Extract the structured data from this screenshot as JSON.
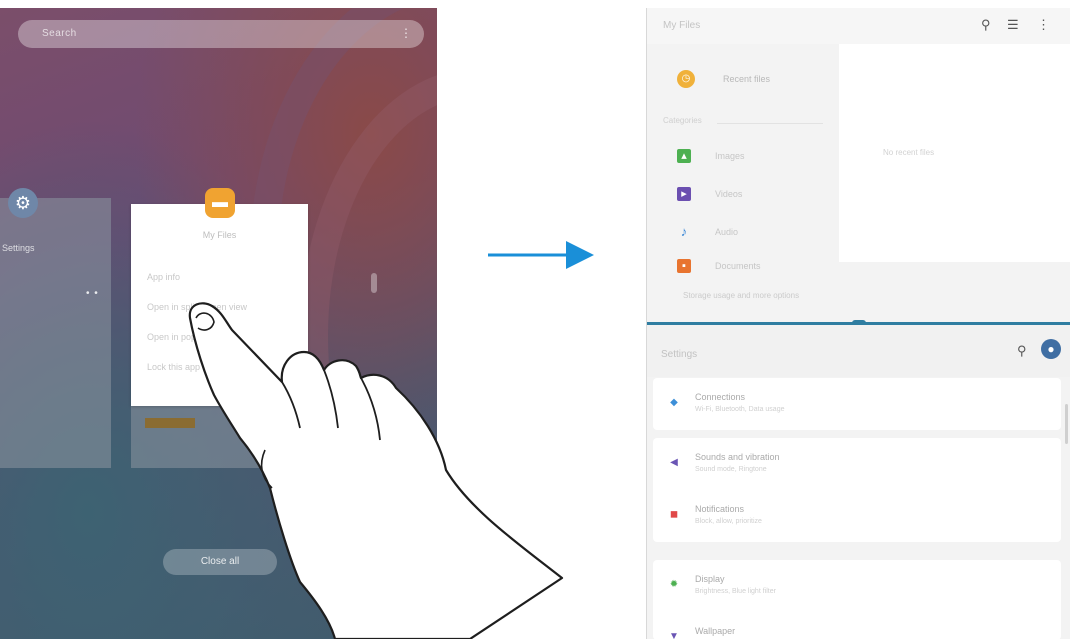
{
  "left_screen": {
    "search_placeholder": "Search",
    "mic_icon": "mic-icon",
    "settings_card": {
      "label": "Settings",
      "dots": "• •"
    },
    "files_card": {
      "title": "My Files",
      "options": [
        "App info",
        "Open in split screen view",
        "Open in pop-up view",
        "Lock this app"
      ]
    },
    "close_all": "Close all"
  },
  "right_screen": {
    "files": {
      "title": "My Files",
      "recent": "Recent files",
      "category_header": "Categories",
      "categories": [
        "Images",
        "Videos",
        "Audio",
        "Documents"
      ],
      "empty_message": "No recent files",
      "storage": "Storage usage and more options"
    },
    "settings": {
      "title": "Settings",
      "rows": [
        {
          "title": "Connections",
          "sub": "Wi-Fi, Bluetooth, Data usage"
        },
        {
          "title": "Sounds and vibration",
          "sub": "Sound mode, Ringtone"
        },
        {
          "title": "Notifications",
          "sub": "Block, allow, prioritize"
        },
        {
          "title": "Display",
          "sub": "Brightness, Blue light filter"
        },
        {
          "title": "Wallpaper",
          "sub": ""
        }
      ]
    }
  },
  "colors": {
    "accent_blue": "#1a8fd8",
    "divider": "#2f7da1",
    "folder_orange": "#f0a331"
  }
}
